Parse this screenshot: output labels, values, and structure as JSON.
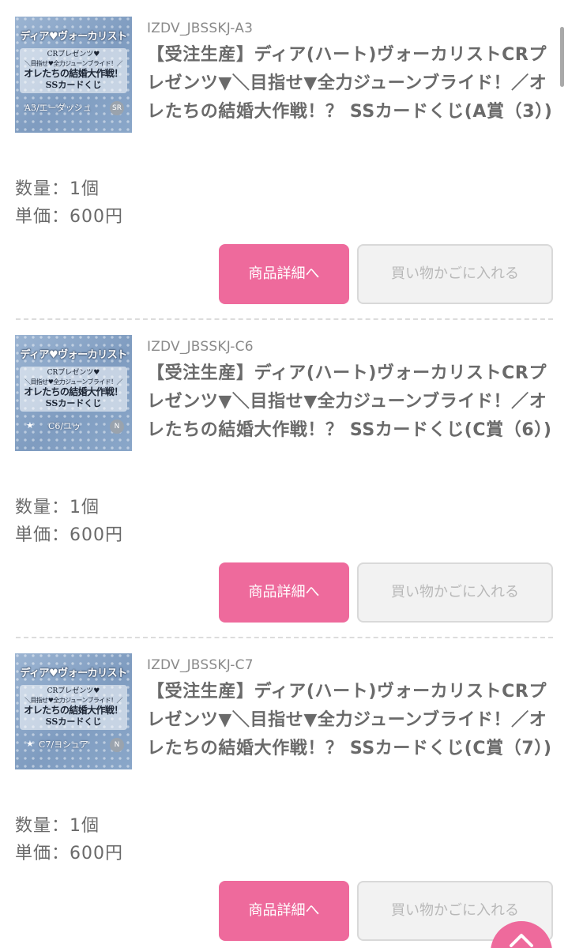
{
  "items": [
    {
      "code": "IZDV_JBSSKJ-A3",
      "title": "【受注生産】ディア(ハート)ヴォーカリストCRプレゼンツ▼＼目指せ▼全力ジューンブライド！／オレたちの結婚大作戦！？ SSカードくじ(A賞（3）)",
      "quantity": "数量：1個",
      "unit_price": "単価：600円",
      "detail_button": "商品詳細へ",
      "cart_button": "買い物かごに入れる",
      "thumb": {
        "title": "ディア♥ヴォーカリスト",
        "line1": "CRプレゼンツ♥",
        "line2": "＼目指せ♥全力ジューンブライド！／",
        "line3": "オレたちの結婚大作戦！",
        "line4": "SSカードくじ",
        "card": "A3/エーダッシュ",
        "rank": "SR"
      }
    },
    {
      "code": "IZDV_JBSSKJ-C6",
      "title": "【受注生産】ディア(ハート)ヴォーカリストCRプレゼンツ▼＼目指せ▼全力ジューンブライド！／オレたちの結婚大作戦！？ SSカードくじ(C賞（6）)",
      "quantity": "数量：1個",
      "unit_price": "単価：600円",
      "detail_button": "商品詳細へ",
      "cart_button": "買い物かごに入れる",
      "thumb": {
        "title": "ディア♥ヴォーカリスト",
        "line1": "CRプレゼンツ♥",
        "line2": "＼目指せ♥全力ジューンブライド！／",
        "line3": "オレたちの結婚大作戦！",
        "line4": "SSカードくじ",
        "card": "C6/ユゥ",
        "rank": "N"
      }
    },
    {
      "code": "IZDV_JBSSKJ-C7",
      "title": "【受注生産】ディア(ハート)ヴォーカリストCRプレゼンツ▼＼目指せ▼全力ジューンブライド！／オレたちの結婚大作戦！？ SSカードくじ(C賞（7）)",
      "quantity": "数量：1個",
      "unit_price": "単価：600円",
      "detail_button": "商品詳細へ",
      "cart_button": "買い物かごに入れる",
      "thumb": {
        "title": "ディア♥ヴォーカリスト",
        "line1": "CRプレゼンツ♥",
        "line2": "＼目指せ♥全力ジューンブライド！／",
        "line3": "オレたちの結婚大作戦！",
        "line4": "SSカードくじ",
        "card": "C7/ヨシュア",
        "rank": "N"
      }
    }
  ],
  "icons": {
    "back_to_top": "chevron-up-icon",
    "star": "star-icon"
  },
  "colors": {
    "accent_pink": "#ee6a9c",
    "disabled_gray": "#f2f2f2",
    "text": "#6a6a6a"
  }
}
